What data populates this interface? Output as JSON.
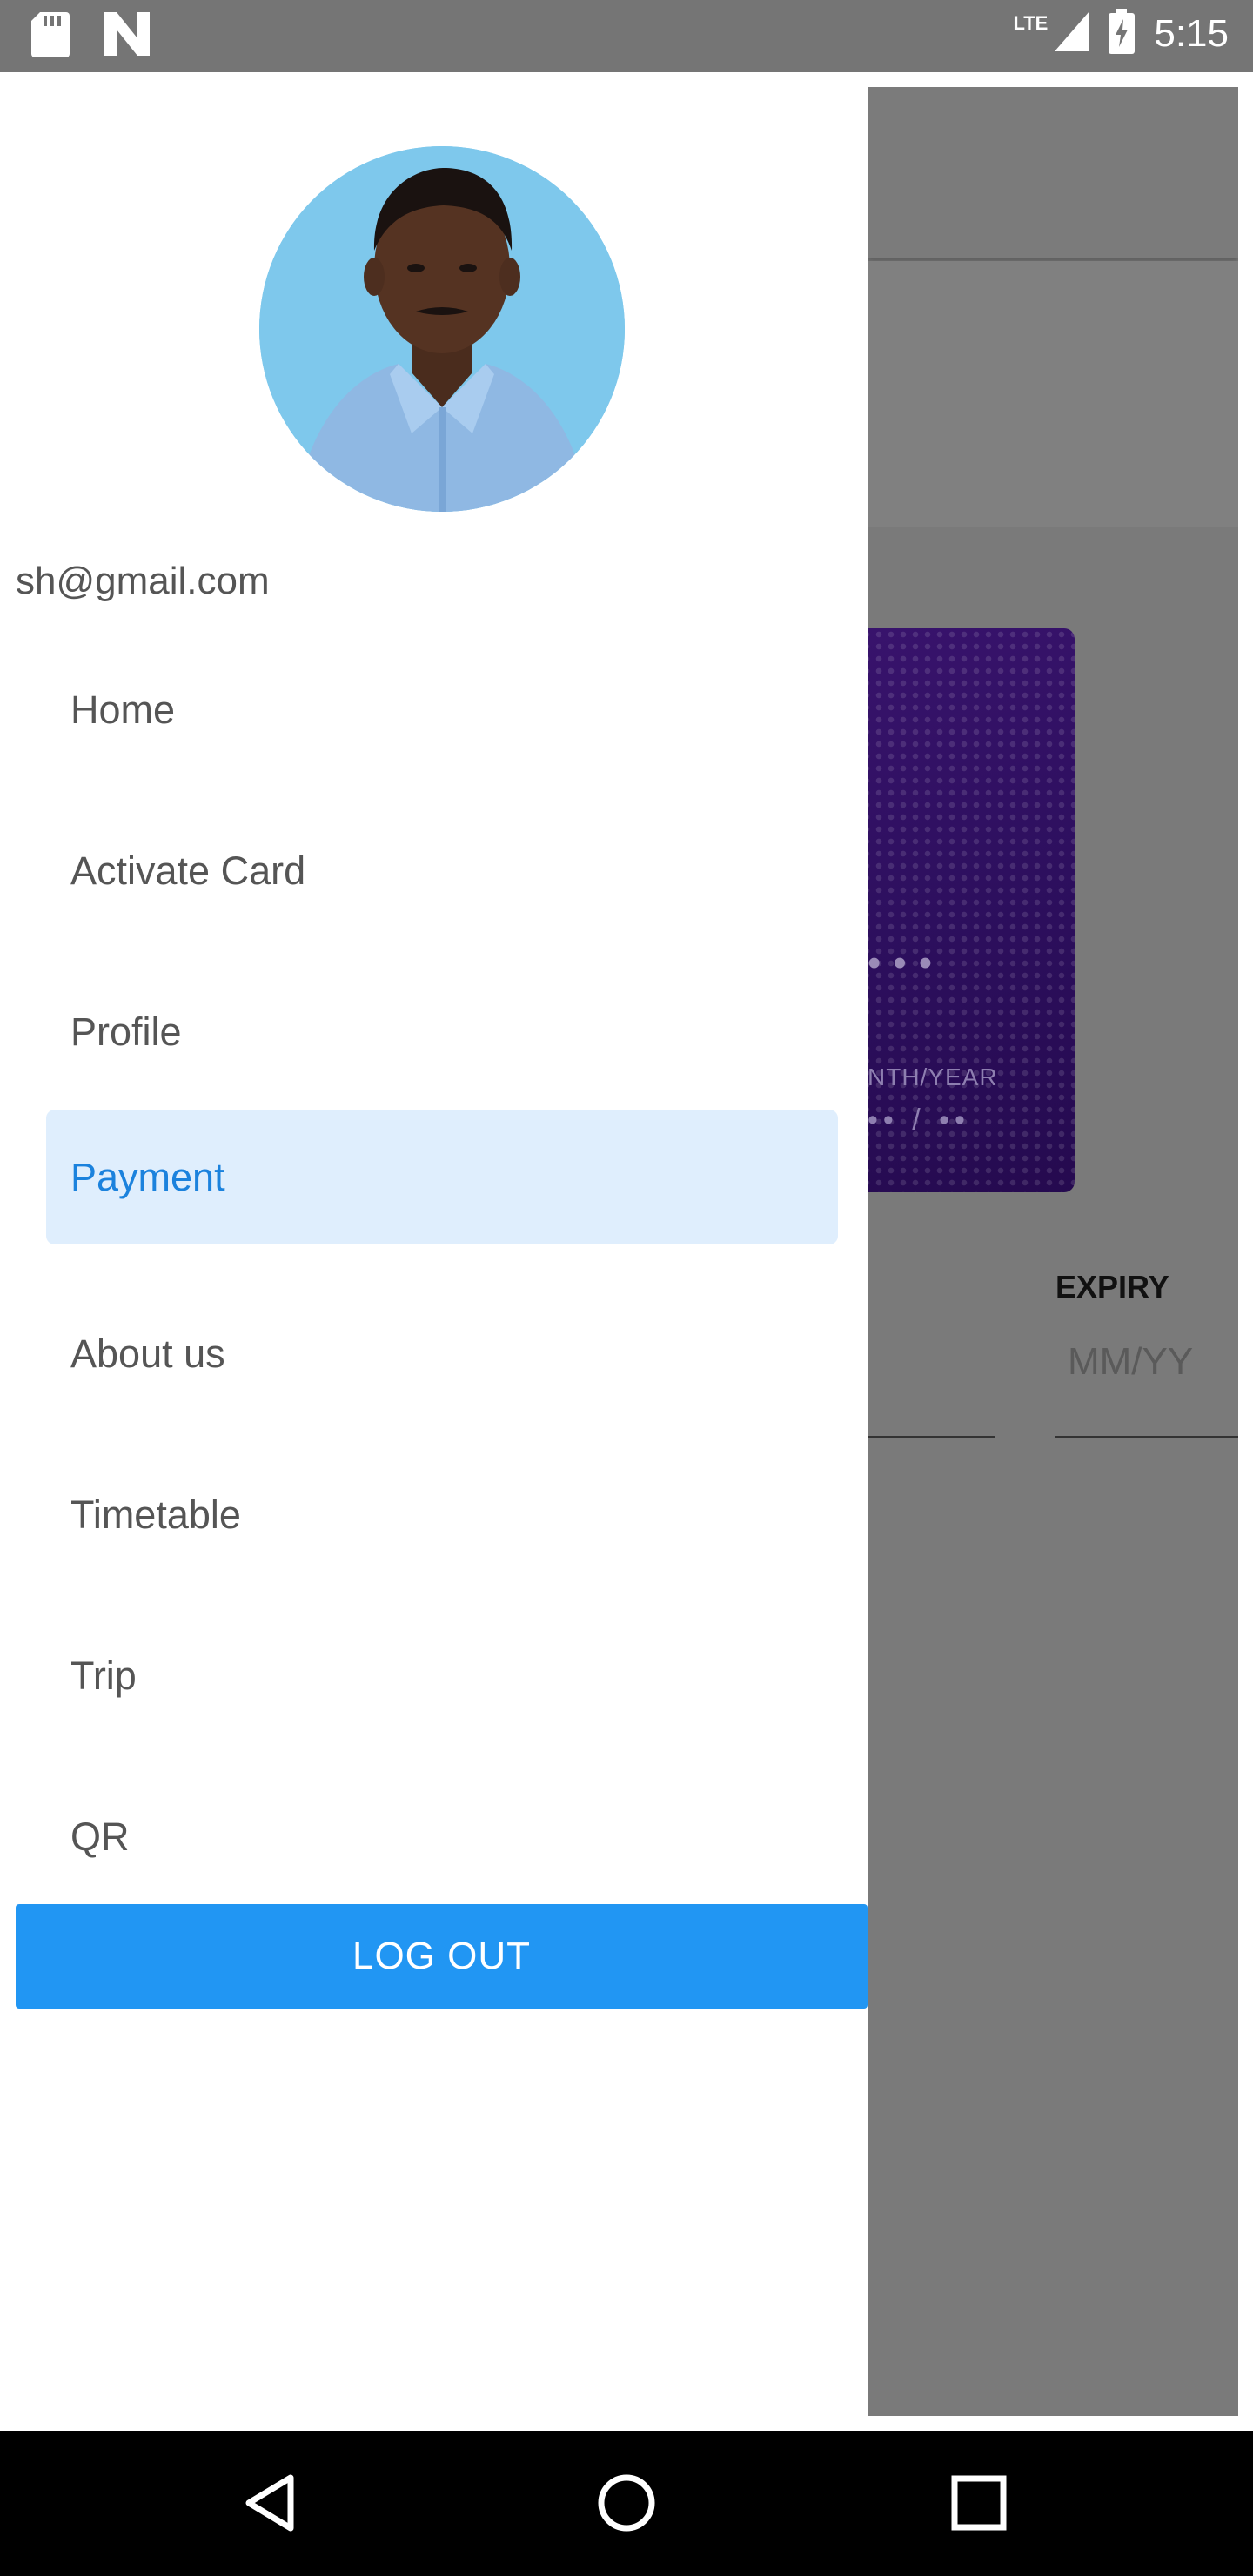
{
  "status_bar": {
    "time": "5:15",
    "network": "LTE",
    "icons": [
      "sd-card-icon",
      "n-icon",
      "signal-icon",
      "battery-icon"
    ]
  },
  "drawer": {
    "email": "sh@gmail.com",
    "menu": [
      {
        "label": "Home"
      },
      {
        "label": "Activate Card"
      },
      {
        "label": "Profile"
      },
      {
        "label": "Payment",
        "active": true
      },
      {
        "label": "About us"
      },
      {
        "label": "Timetable"
      },
      {
        "label": "Trip"
      },
      {
        "label": "QR"
      }
    ],
    "logout_label": "LOG OUT"
  },
  "background": {
    "card_label": "NTH/YEAR",
    "card_date": "•• / ••",
    "card_dots": "•••",
    "expiry_label": "EXPIRY",
    "expiry_placeholder": "MM/YY"
  },
  "colors": {
    "accent": "#2196f3",
    "active_bg": "#dfeefd",
    "active_text": "#1b82dd",
    "card": "#2d0f5e"
  }
}
